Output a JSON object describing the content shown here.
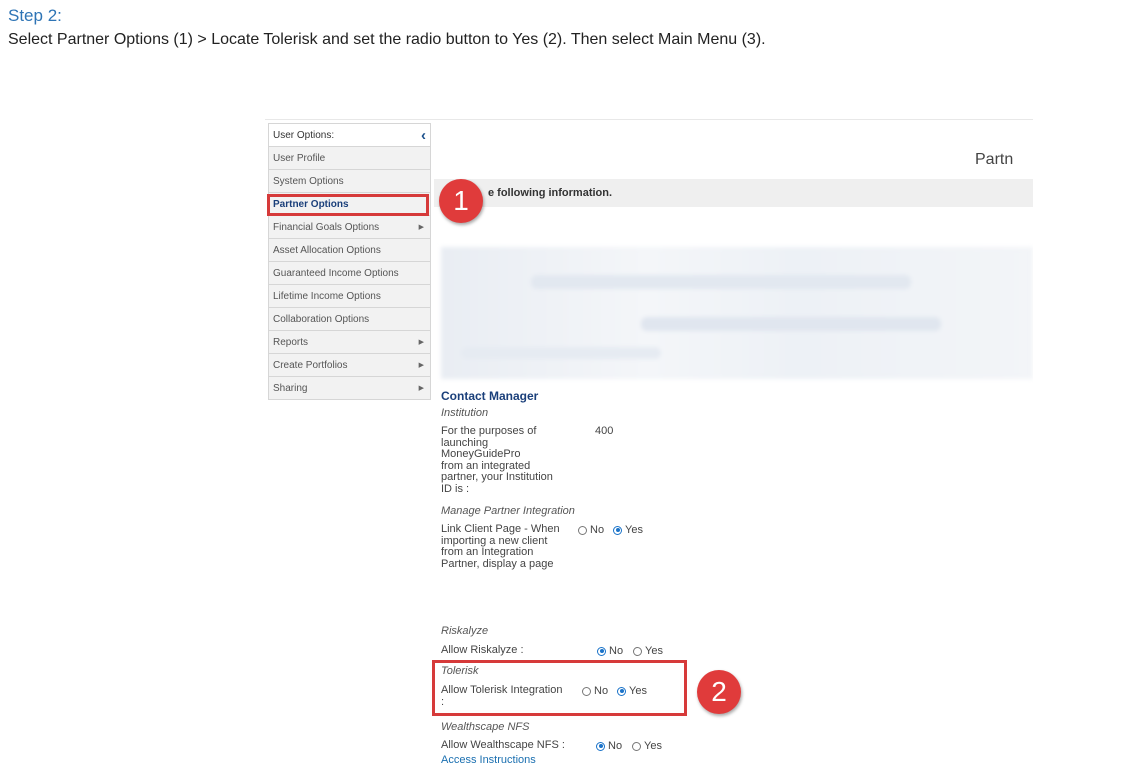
{
  "step": {
    "title": "Step 2:",
    "text": "Select Partner Options (1) > Locate Tolerisk and set the radio button to Yes (2). Then select Main Menu (3)."
  },
  "sidebar": {
    "header": "User Options:",
    "collapse_icon": "chevron-left-icon",
    "items": [
      {
        "label": "User Profile",
        "arrow": false
      },
      {
        "label": "System Options",
        "arrow": false
      },
      {
        "label": "Partner Options",
        "arrow": false,
        "active": true
      },
      {
        "label": "Financial Goals Options",
        "arrow": true
      },
      {
        "label": "Asset Allocation Options",
        "arrow": false
      },
      {
        "label": "Guaranteed Income Options",
        "arrow": false
      },
      {
        "label": "Lifetime Income Options",
        "arrow": false
      },
      {
        "label": "Collaboration Options",
        "arrow": false
      },
      {
        "label": "Reports",
        "arrow": true
      },
      {
        "label": "Create Portfolios",
        "arrow": true
      },
      {
        "label": "Sharing",
        "arrow": true
      }
    ]
  },
  "main": {
    "header_partial": "Partn",
    "info_text": "e following information."
  },
  "callouts": {
    "one": "1",
    "two": "2"
  },
  "contact_manager": {
    "title": "Contact Manager",
    "institution_heading": "Institution",
    "institution_lines": [
      "For the purposes of",
      "launching",
      "MoneyGuidePro",
      "from an integrated",
      "partner, your Institution",
      "ID is :"
    ],
    "institution_id": "400",
    "manage_heading": "Manage Partner Integration",
    "link_client_lines": [
      "Link Client Page - When",
      "importing a new client",
      "from an Integration",
      "Partner, display a page"
    ],
    "link_client_no": "No",
    "link_client_yes": "Yes",
    "riskalyze_heading": "Riskalyze",
    "riskalyze_label": "Allow Riskalyze :",
    "riskalyze_no": "No",
    "riskalyze_yes": "Yes",
    "tolerisk_heading": "Tolerisk",
    "tolerisk_label": "Allow Tolerisk Integration",
    "tolerisk_colon": ":",
    "tolerisk_no": "No",
    "tolerisk_yes": "Yes",
    "wealthscape_heading": "Wealthscape NFS",
    "wealthscape_label": "Allow Wealthscape NFS :",
    "wealthscape_no": "No",
    "wealthscape_yes": "Yes",
    "access_instructions": "Access Instructions"
  },
  "colors": {
    "step_blue": "#2E74B5",
    "callout_red": "#e03b3b",
    "nav_blue": "#1a3f7a",
    "radio_blue": "#1a73c9"
  }
}
